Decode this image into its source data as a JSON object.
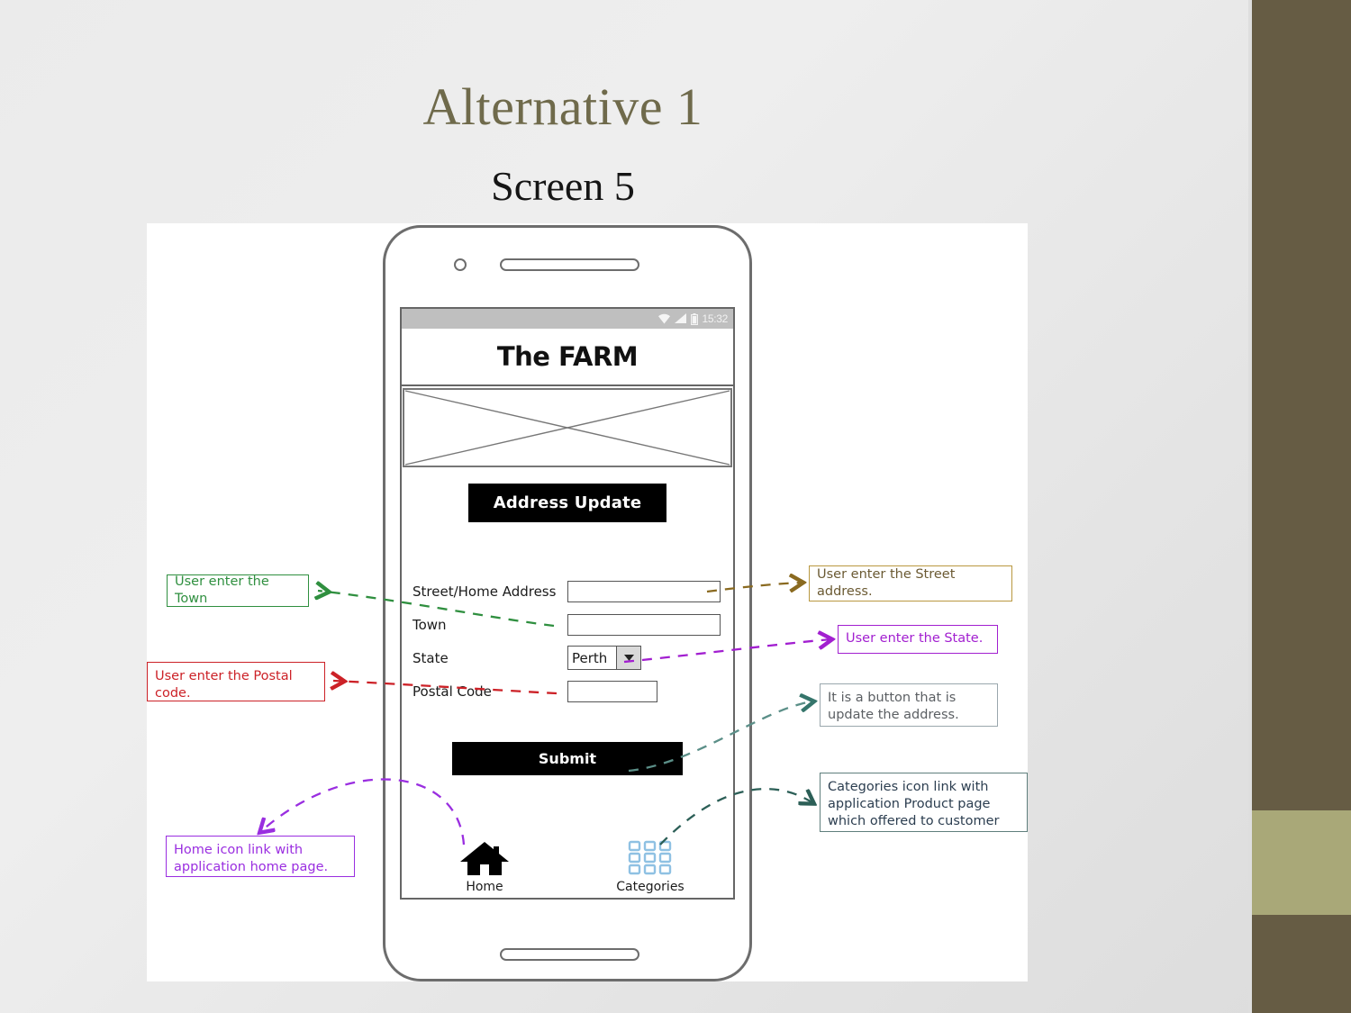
{
  "slide": {
    "title": "Alternative 1",
    "subtitle": "Screen 5"
  },
  "phone": {
    "status_bar": {
      "time": "15:32",
      "icons": [
        "wifi-icon",
        "signal-icon",
        "battery-icon"
      ]
    },
    "app_title": "The FARM",
    "image_placeholder": "image-placeholder-x",
    "page_button": "Address Update",
    "form": {
      "fields": [
        {
          "label": "Street/Home Address",
          "type": "text",
          "value": ""
        },
        {
          "label": "Town",
          "type": "text",
          "value": ""
        },
        {
          "label": "State",
          "type": "select",
          "value": "Perth"
        },
        {
          "label": "Postal Code",
          "type": "text",
          "value": ""
        }
      ]
    },
    "submit_label": "Submit",
    "bottom_nav": [
      {
        "label": "Home",
        "icon": "home-icon"
      },
      {
        "label": "Categories",
        "icon": "grid-categories-icon"
      }
    ]
  },
  "annotations": [
    {
      "id": "town",
      "text": "User enter the Town",
      "color": "#2f8f3f"
    },
    {
      "id": "postal",
      "text": "User enter the Postal code.",
      "color": "#cc2127"
    },
    {
      "id": "home",
      "text": "Home icon link with application home page.",
      "color": "#9a2ee0"
    },
    {
      "id": "street",
      "text": "User enter the Street address.",
      "color": "#8a6a20"
    },
    {
      "id": "state",
      "text": "User enter the State.",
      "color": "#a21fd0"
    },
    {
      "id": "submit",
      "text": "It is a button that is update the address.",
      "color": "#5b5f63"
    },
    {
      "id": "categories",
      "text": "Categories icon link with application Product page which offered to customer",
      "color": "#2c3e50"
    }
  ],
  "theme": {
    "title_color": "#6f6a4b",
    "sidebar_dark": "#665c44",
    "sidebar_light": "#a9a878",
    "background": "#ececec"
  }
}
